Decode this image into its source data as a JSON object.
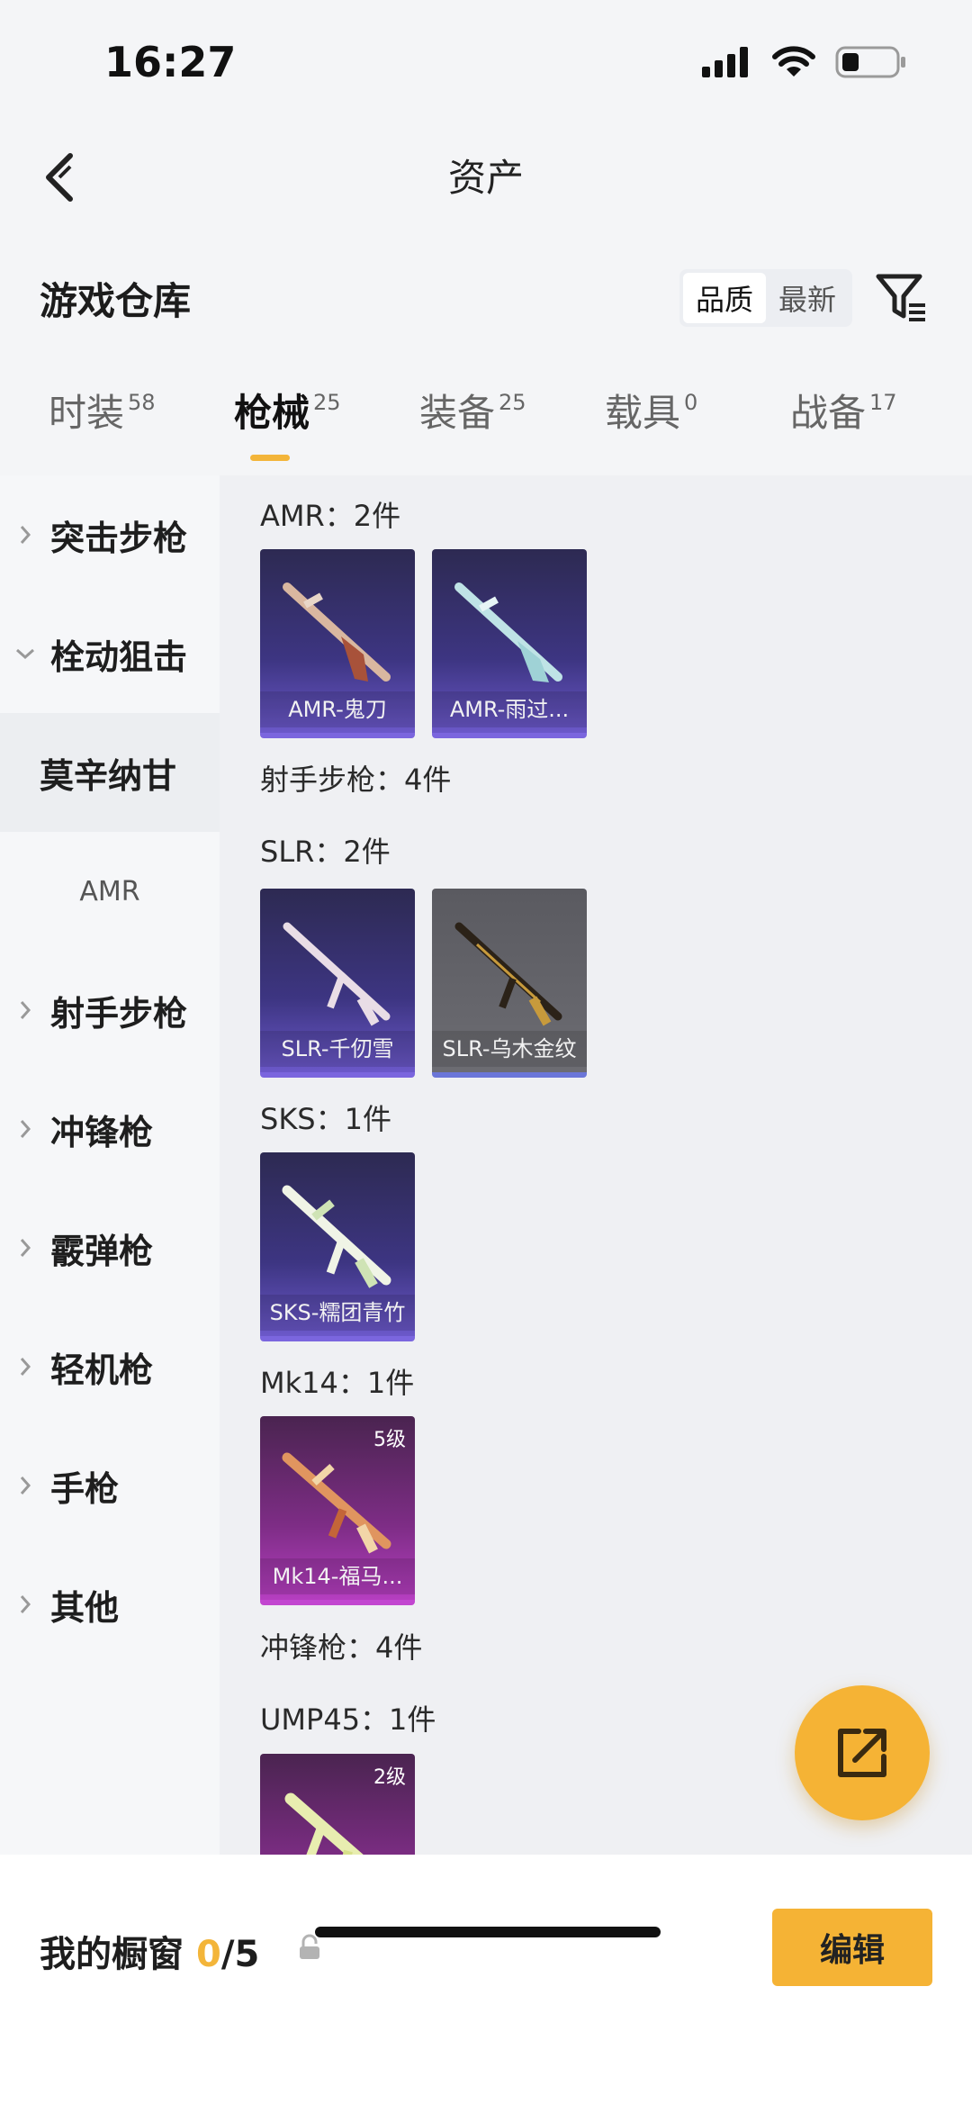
{
  "status_bar": {
    "time": "16:27",
    "icons": [
      "signal-icon",
      "wifi-icon",
      "battery-icon"
    ]
  },
  "nav": {
    "title": "资产"
  },
  "header": {
    "title": "游戏仓库",
    "sort_options": [
      "品质",
      "最新"
    ],
    "sort_active": "品质"
  },
  "tabs": [
    {
      "label": "时装",
      "count": "58"
    },
    {
      "label": "枪械",
      "count": "25",
      "active": true
    },
    {
      "label": "装备",
      "count": "25"
    },
    {
      "label": "载具",
      "count": "0"
    },
    {
      "label": "战备",
      "count": "17"
    }
  ],
  "sidebar": {
    "items": [
      {
        "label": "突击步枪"
      },
      {
        "label": "栓动狙击"
      },
      {
        "label": "莫辛纳甘"
      },
      {
        "label": "AMR"
      },
      {
        "label": "射手步枪"
      },
      {
        "label": "冲锋枪"
      },
      {
        "label": "霰弹枪"
      },
      {
        "label": "轻机枪"
      },
      {
        "label": "手枪"
      },
      {
        "label": "其他"
      }
    ]
  },
  "content": {
    "groups": [
      {
        "label": "AMR：2件"
      },
      {
        "label": "射手步枪：4件"
      },
      {
        "label": "SLR：2件"
      },
      {
        "label": "SKS：1件"
      },
      {
        "label": "Mk14：1件"
      },
      {
        "label": "冲锋枪：4件"
      },
      {
        "label": "UMP45：1件"
      }
    ],
    "cards": [
      {
        "name": "AMR-鬼刀",
        "rarity": "blue"
      },
      {
        "name": "AMR-雨过...",
        "rarity": "blue"
      },
      {
        "name": "SLR-千仞雪",
        "rarity": "blue"
      },
      {
        "name": "SLR-乌木金纹",
        "rarity": "grey"
      },
      {
        "name": "SKS-糯团青竹",
        "rarity": "blue"
      },
      {
        "name": "Mk14-福马...",
        "rarity": "purple",
        "level": "5级"
      },
      {
        "name": "",
        "rarity": "purple",
        "level": "2级"
      }
    ]
  },
  "bottom": {
    "showcase_label": "我的橱窗",
    "showcase_count": "0",
    "showcase_max": "/5",
    "edit_label": "编辑"
  },
  "colors": {
    "accent": "#f3b53a",
    "blue_card": "#3d3582",
    "purple_card": "#b53ec0"
  }
}
